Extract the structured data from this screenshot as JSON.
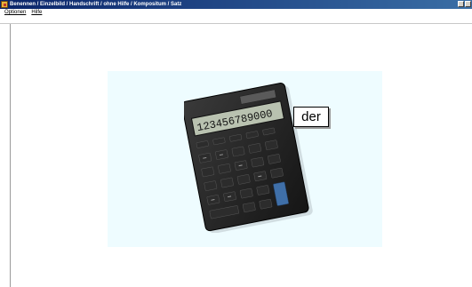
{
  "window": {
    "title": "Benennen / Einzelbild / Handschrift / ohne Hilfe / Kompositum / Satz"
  },
  "menu": {
    "items": [
      {
        "label": "Optionen"
      },
      {
        "label": "Hilfe"
      }
    ]
  },
  "main": {
    "word_label": "der",
    "calculator_display": "123456789000"
  }
}
